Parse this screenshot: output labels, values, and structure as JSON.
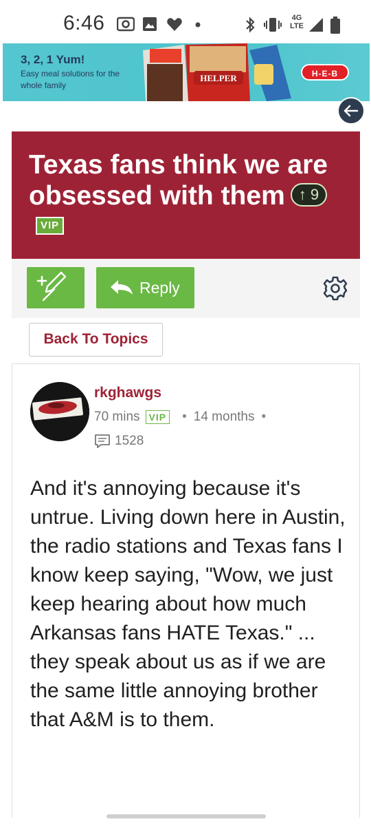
{
  "status_bar": {
    "time": "6:46",
    "network": "4G LTE",
    "icons": [
      "cast-icon",
      "image-icon",
      "heart-icon",
      "dot-icon",
      "bluetooth-icon",
      "vibrate-icon",
      "signal-icon",
      "battery-icon"
    ]
  },
  "ad": {
    "title": "3, 2, 1 Yum!",
    "subtitle": "Easy meal solutions for the whole family",
    "product_label": "HELPER",
    "logo": "H-E-B"
  },
  "topic": {
    "title": "Texas fans think we are obsessed with them",
    "votes": "9",
    "vip_label": "VIP"
  },
  "toolbar": {
    "reply_label": "Reply",
    "icons": [
      "new-post-icon",
      "reply-arrow-icon",
      "gear-icon"
    ]
  },
  "nav": {
    "back_to_topics": "Back To Topics"
  },
  "post": {
    "author": "rkghawgs",
    "time_ago": "70 mins",
    "vip_label": "VIP",
    "member_since": "14 months",
    "post_count": "1528",
    "body": "And it's annoying because it's untrue. Living down here in Austin, the radio stations and Texas fans I know keep saying, \"Wow, we just keep hearing about how much Arkansas fans HATE Texas.\" ... they speak about us as if we are the same little annoying brother that A&M is to them."
  },
  "colors": {
    "brand": "#9e2236",
    "accent_green": "#6ab945",
    "ad_bg": "#4cc4cc"
  }
}
